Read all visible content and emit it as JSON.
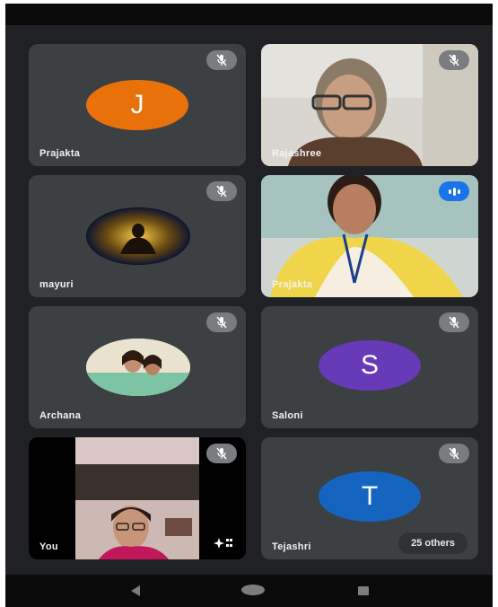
{
  "participants": [
    {
      "name": "Prajakta",
      "type": "letter",
      "letter": "J",
      "color": "#e8710a",
      "mic": "muted"
    },
    {
      "name": "Rajashree",
      "type": "video",
      "mic": "muted"
    },
    {
      "name": "mayuri",
      "type": "image",
      "mic": "muted"
    },
    {
      "name": "Prajakta",
      "type": "video",
      "mic": "speaking"
    },
    {
      "name": "Archana",
      "type": "image",
      "mic": "muted"
    },
    {
      "name": "Saloni",
      "type": "letter",
      "letter": "S",
      "color": "#673ab7",
      "mic": "muted"
    },
    {
      "name": "You",
      "type": "video",
      "mic": "muted"
    },
    {
      "name": "Tejashri",
      "type": "letter",
      "letter": "T",
      "color": "#1565c0",
      "mic": "muted"
    }
  ],
  "others_label": "25 others",
  "effects_icon": "sparkle-effects-icon",
  "nav": {
    "back_icon": "back-triangle-icon",
    "home_icon": "home-icon",
    "recents_icon": "recents-icon"
  }
}
